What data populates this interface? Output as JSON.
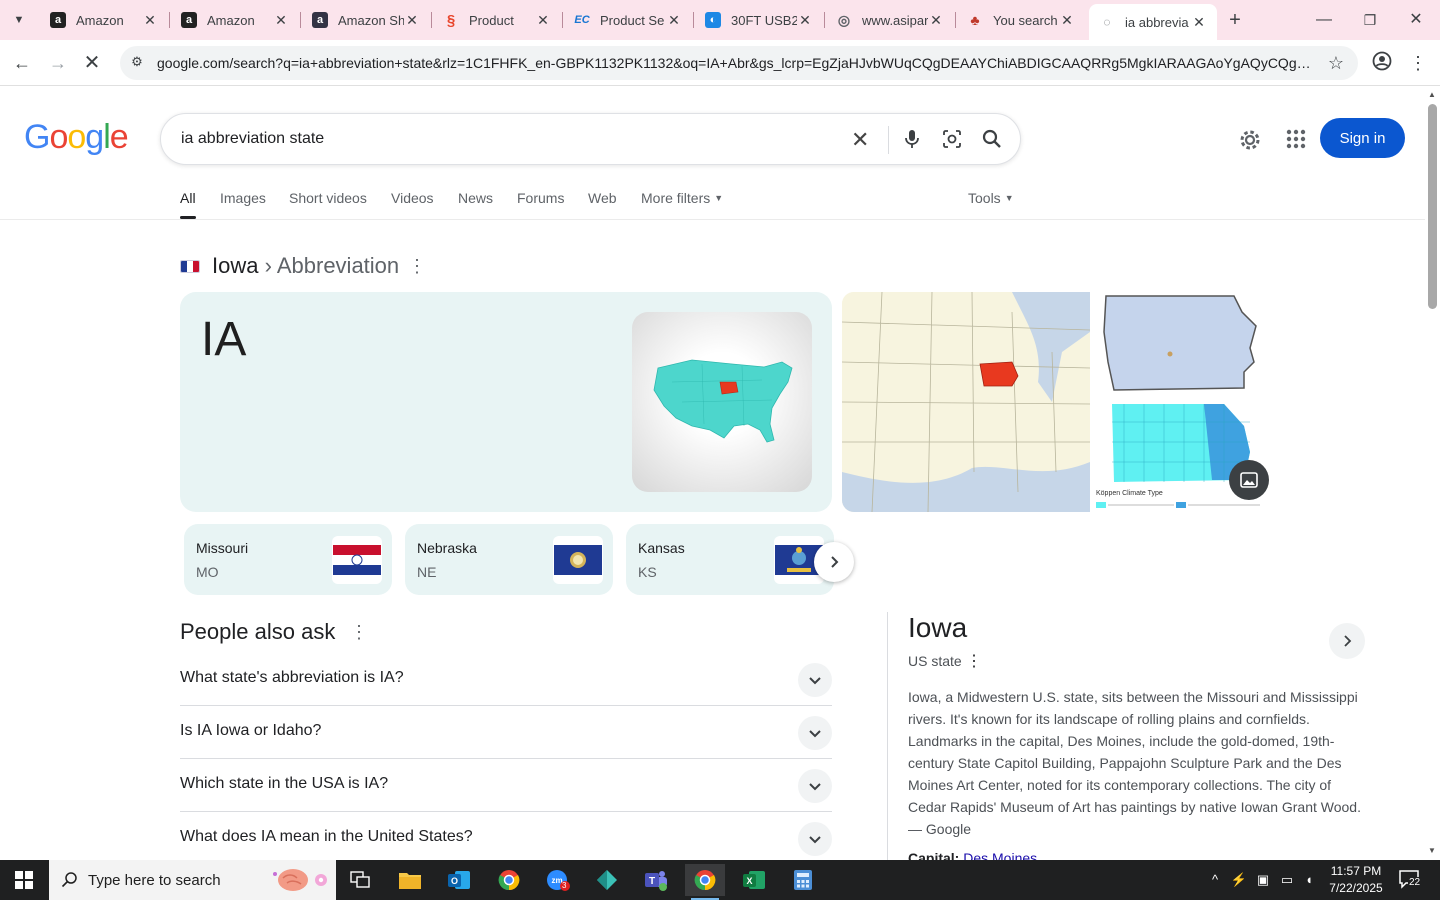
{
  "browser": {
    "tabs": [
      {
        "title": "Amazon",
        "icon": "amazon-icon"
      },
      {
        "title": "Amazon",
        "icon": "amazon-icon"
      },
      {
        "title": "Amazon Sh",
        "icon": "amazon-icon"
      },
      {
        "title": "Product",
        "icon": "product-icon"
      },
      {
        "title": "Product Se",
        "icon": "ec-icon"
      },
      {
        "title": "30FT USB2.",
        "icon": "lamp-icon"
      },
      {
        "title": "www.asipar",
        "icon": "globe-icon"
      },
      {
        "title": "You search",
        "icon": "you-icon"
      },
      {
        "title": "ia abbrevia",
        "icon": "loading-icon",
        "active": true
      }
    ],
    "url": "google.com/search?q=ia+abbreviation+state&rlz=1C1FHFK_en-GBPK1132PK1132&oq=IA+Abr&gs_lcrp=EgZjaHJvbWUqCQgDEAAYChiABDIGCAAQRRg5MgkIARAAGAoYgAQyCQgCEAA..."
  },
  "google": {
    "query": "ia abbreviation state",
    "sign_in": "Sign in",
    "nav": [
      "All",
      "Images",
      "Short videos",
      "Videos",
      "News",
      "Forums",
      "Web",
      "More filters",
      "Tools"
    ]
  },
  "answer": {
    "entity": "Iowa",
    "attribute": "Abbreviation",
    "value": "IA",
    "climate_label": "Köppen Climate Type"
  },
  "related_states": [
    {
      "name": "Missouri",
      "abbr": "MO"
    },
    {
      "name": "Nebraska",
      "abbr": "NE"
    },
    {
      "name": "Kansas",
      "abbr": "KS"
    }
  ],
  "paa": {
    "title": "People also ask",
    "questions": [
      "What state's abbreviation is IA?",
      "Is IA Iowa or Idaho?",
      "Which state in the USA is IA?",
      "What does IA mean in the United States?"
    ]
  },
  "knowledge_panel": {
    "title": "Iowa",
    "subtitle": "US state",
    "description": "Iowa, a Midwestern U.S. state, sits between the Missouri and Mississippi rivers. It's known for its landscape of rolling plains and cornfields. Landmarks in the capital, Des Moines, include the gold-domed, 19th-century State Capitol Building, Pappajohn Sculpture Park and the Des Moines Art Center, noted for its contemporary collections. The city of Cedar Rapids' Museum of Art has paintings by native Iowan Grant Wood.",
    "source": "— Google",
    "capital_label": "Capital:",
    "capital_value": "Des Moines"
  },
  "taskbar": {
    "search_placeholder": "Type here to search",
    "time": "11:57 PM",
    "date": "7/22/2025",
    "notifications": "22",
    "zoom_badge": "3"
  },
  "colors": {
    "accent": "#0b57d0",
    "tab_strip": "#fbe4ec",
    "card_bg": "#e8f4f4",
    "iowa_highlight": "#e8391f",
    "usa_teal": "#4dd6cc"
  }
}
